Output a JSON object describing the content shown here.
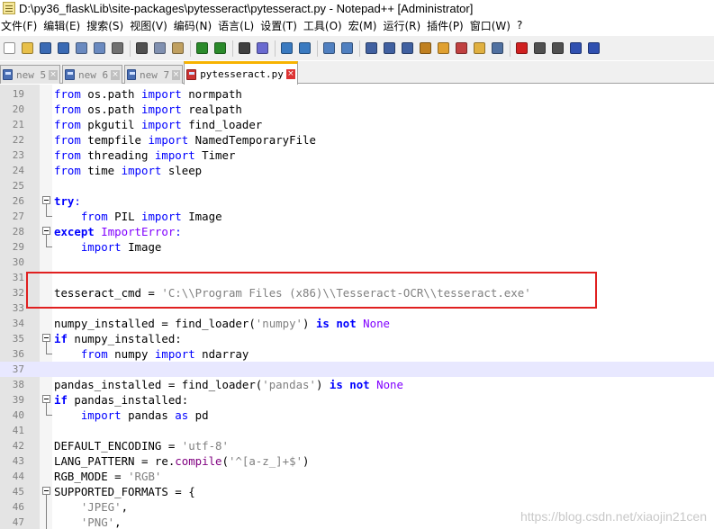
{
  "window": {
    "title": "D:\\py36_flask\\Lib\\site-packages\\pytesseract\\pytesseract.py - Notepad++ [Administrator]"
  },
  "menu": [
    "文件(F)",
    "编辑(E)",
    "搜索(S)",
    "视图(V)",
    "编码(N)",
    "语言(L)",
    "设置(T)",
    "工具(O)",
    "宏(M)",
    "运行(R)",
    "插件(P)",
    "窗口(W)",
    "?"
  ],
  "toolbar": {
    "groups": [
      [
        "new-file-icon",
        "open-file-icon",
        "save-icon",
        "save-all-icon",
        "close-icon",
        "close-all-icon",
        "print-icon"
      ],
      [
        "cut-icon",
        "copy-icon",
        "paste-icon"
      ],
      [
        "undo-icon",
        "redo-icon"
      ],
      [
        "find-icon",
        "replace-icon"
      ],
      [
        "zoom-in-icon",
        "zoom-out-icon"
      ],
      [
        "sync-vertical-icon",
        "sync-horizontal-icon"
      ],
      [
        "word-wrap-icon",
        "show-all-chars-icon",
        "indent-guide-icon",
        "language-icon",
        "doc-map-icon",
        "function-list-icon",
        "folder-workspace-icon",
        "monitor-icon"
      ],
      [
        "record-macro-icon",
        "stop-record-icon",
        "play-macro-icon",
        "play-multiple-icon",
        "save-macro-icon"
      ]
    ]
  },
  "tabs": [
    {
      "label": "new 5",
      "active": false,
      "modified": false
    },
    {
      "label": "new 6",
      "active": false,
      "modified": false
    },
    {
      "label": "new 7",
      "active": false,
      "modified": false
    },
    {
      "label": "pytesseract.py",
      "active": true,
      "modified": true
    }
  ],
  "editor": {
    "current_line": 37,
    "highlighted_line": 32,
    "lines": [
      {
        "n": "19",
        "tokens": [
          [
            "kw",
            "from"
          ],
          [
            "",
            " os.path "
          ],
          [
            "kw",
            "import"
          ],
          [
            "",
            " normpath"
          ]
        ]
      },
      {
        "n": "20",
        "tokens": [
          [
            "kw",
            "from"
          ],
          [
            "",
            " os.path "
          ],
          [
            "kw",
            "import"
          ],
          [
            "",
            " realpath"
          ]
        ]
      },
      {
        "n": "21",
        "tokens": [
          [
            "kw",
            "from"
          ],
          [
            "",
            " pkgutil "
          ],
          [
            "kw",
            "import"
          ],
          [
            "",
            " find_loader"
          ]
        ]
      },
      {
        "n": "22",
        "tokens": [
          [
            "kw",
            "from"
          ],
          [
            "",
            " tempfile "
          ],
          [
            "kw",
            "import"
          ],
          [
            "",
            " NamedTemporaryFile"
          ]
        ]
      },
      {
        "n": "23",
        "tokens": [
          [
            "kw",
            "from"
          ],
          [
            "",
            " threading "
          ],
          [
            "kw",
            "import"
          ],
          [
            "",
            " Timer"
          ]
        ]
      },
      {
        "n": "24",
        "tokens": [
          [
            "kw",
            "from"
          ],
          [
            "",
            " time "
          ],
          [
            "kw",
            "import"
          ],
          [
            "",
            " sleep"
          ]
        ]
      },
      {
        "n": "25",
        "tokens": []
      },
      {
        "n": "26",
        "fold": "open",
        "tokens": [
          [
            "kwb",
            "try"
          ],
          [
            "kw",
            ":"
          ]
        ]
      },
      {
        "n": "27",
        "fold": "end",
        "tokens": [
          [
            "",
            "    "
          ],
          [
            "kw",
            "from"
          ],
          [
            "",
            " PIL "
          ],
          [
            "kw",
            "import"
          ],
          [
            "",
            " Image"
          ]
        ]
      },
      {
        "n": "28",
        "fold": "open",
        "tokens": [
          [
            "kwb",
            "except"
          ],
          [
            "",
            " "
          ],
          [
            "exc",
            "ImportError"
          ],
          [
            "kw",
            ":"
          ]
        ]
      },
      {
        "n": "29",
        "fold": "end",
        "tokens": [
          [
            "",
            "    "
          ],
          [
            "kw",
            "import"
          ],
          [
            "",
            " Image"
          ]
        ]
      },
      {
        "n": "30",
        "tokens": []
      },
      {
        "n": "31",
        "tokens": []
      },
      {
        "n": "32",
        "tokens": [
          [
            "",
            "tesseract_cmd = "
          ],
          [
            "str",
            "'C:\\\\Program Files (x86)\\\\Tesseract-OCR\\\\tesseract.exe'"
          ]
        ]
      },
      {
        "n": "33",
        "tokens": []
      },
      {
        "n": "34",
        "tokens": [
          [
            "",
            "numpy_installed = find_loader("
          ],
          [
            "str",
            "'numpy'"
          ],
          [
            "",
            ") "
          ],
          [
            "kwb",
            "is not"
          ],
          [
            "",
            " "
          ],
          [
            "exc",
            "None"
          ]
        ]
      },
      {
        "n": "35",
        "fold": "open",
        "tokens": [
          [
            "kwb",
            "if"
          ],
          [
            "",
            " numpy_installed:"
          ]
        ]
      },
      {
        "n": "36",
        "fold": "end",
        "tokens": [
          [
            "",
            "    "
          ],
          [
            "kw",
            "from"
          ],
          [
            "",
            " numpy "
          ],
          [
            "kw",
            "import"
          ],
          [
            "",
            " ndarray"
          ]
        ]
      },
      {
        "n": "37",
        "tokens": []
      },
      {
        "n": "38",
        "tokens": [
          [
            "",
            "pandas_installed = find_loader("
          ],
          [
            "str",
            "'pandas'"
          ],
          [
            "",
            ") "
          ],
          [
            "kwb",
            "is not"
          ],
          [
            "",
            " "
          ],
          [
            "exc",
            "None"
          ]
        ]
      },
      {
        "n": "39",
        "fold": "open",
        "tokens": [
          [
            "kwb",
            "if"
          ],
          [
            "",
            " pandas_installed:"
          ]
        ]
      },
      {
        "n": "40",
        "fold": "end",
        "tokens": [
          [
            "",
            "    "
          ],
          [
            "kw",
            "import"
          ],
          [
            "",
            " pandas "
          ],
          [
            "kw",
            "as"
          ],
          [
            "",
            " pd"
          ]
        ]
      },
      {
        "n": "41",
        "tokens": []
      },
      {
        "n": "42",
        "tokens": [
          [
            "",
            "DEFAULT_ENCODING = "
          ],
          [
            "str",
            "'utf-8'"
          ]
        ]
      },
      {
        "n": "43",
        "tokens": [
          [
            "",
            "LANG_PATTERN = re."
          ],
          [
            "callf",
            "compile"
          ],
          [
            "",
            "("
          ],
          [
            "str",
            "'^[a-z_]+$'"
          ],
          [
            "",
            ")"
          ]
        ]
      },
      {
        "n": "44",
        "tokens": [
          [
            "",
            "RGB_MODE = "
          ],
          [
            "str",
            "'RGB'"
          ]
        ]
      },
      {
        "n": "45",
        "fold": "open",
        "tokens": [
          [
            "",
            "SUPPORTED_FORMATS = {"
          ]
        ]
      },
      {
        "n": "46",
        "fold": "line",
        "tokens": [
          [
            "",
            "    "
          ],
          [
            "str",
            "'JPEG'"
          ],
          [
            "",
            ","
          ]
        ]
      },
      {
        "n": "47",
        "fold": "line",
        "tokens": [
          [
            "",
            "    "
          ],
          [
            "str",
            "'PNG'"
          ],
          [
            "",
            ","
          ]
        ]
      }
    ]
  },
  "watermark": "https://blog.csdn.net/xiaojin21cen",
  "colors": {
    "keyword": "#0000ff",
    "string": "#808080",
    "exception": "#8000ff",
    "highlight_box": "#e02020",
    "current_line": "#e8e8ff"
  }
}
